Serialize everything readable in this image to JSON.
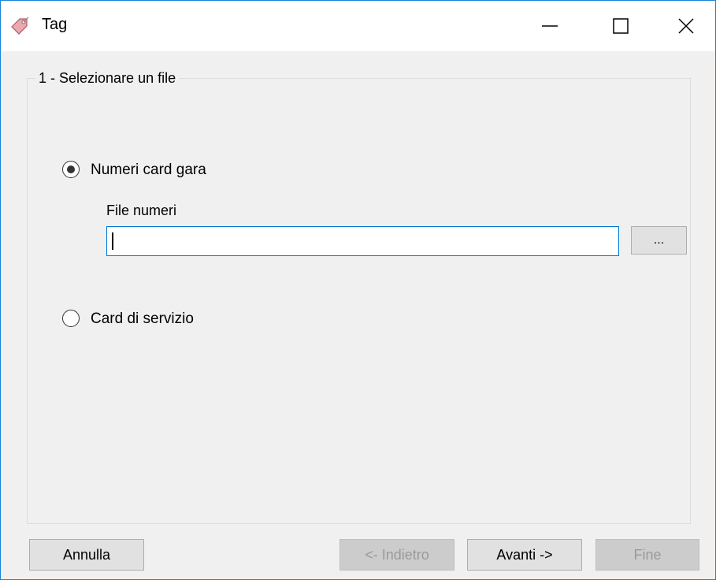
{
  "window": {
    "title": "Tag",
    "app_icon": "tag-icon"
  },
  "titlebar_controls": {
    "minimize": "minimize-icon",
    "maximize": "maximize-icon",
    "close": "close-icon"
  },
  "step": {
    "title": "1 - Selezionare un file"
  },
  "options": [
    {
      "label": "Numeri card gara",
      "selected": true
    },
    {
      "label": "Card di servizio",
      "selected": false
    }
  ],
  "file": {
    "label": "File numeri",
    "value": "",
    "browse_label": "..."
  },
  "buttons": {
    "cancel": "Annulla",
    "back": "<- Indietro",
    "next": "Avanti ->",
    "finish": "Fine"
  },
  "colors": {
    "accent": "#0078d7",
    "window_border": "#1883d7",
    "background": "#f0f0f0"
  }
}
